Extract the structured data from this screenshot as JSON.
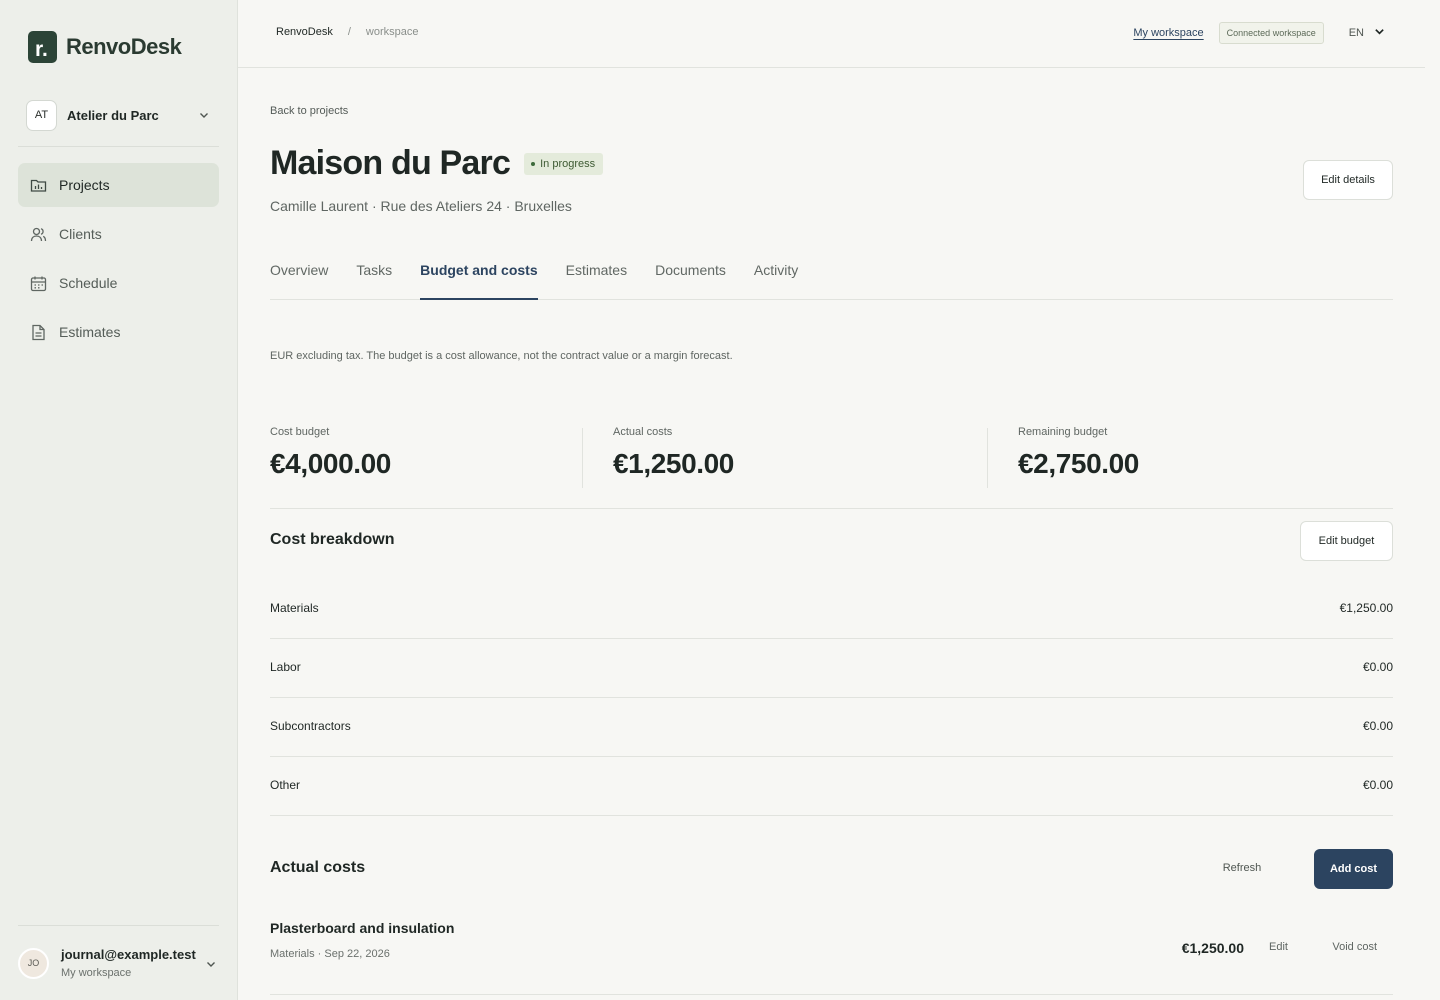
{
  "brand": {
    "mark": "r.",
    "name": "RenvoDesk"
  },
  "org": {
    "initials": "AT",
    "name": "Atelier du Parc"
  },
  "nav": [
    {
      "label": "Projects",
      "icon": "folder-icon"
    },
    {
      "label": "Clients",
      "icon": "users-icon"
    },
    {
      "label": "Schedule",
      "icon": "calendar-icon"
    },
    {
      "label": "Estimates",
      "icon": "document-icon"
    }
  ],
  "user": {
    "initials": "JO",
    "email": "journal@example.test",
    "workspace": "My workspace"
  },
  "topbar": {
    "breadcrumb": [
      "RenvoDesk",
      "/",
      "workspace"
    ],
    "workspace_link": "My workspace",
    "workspace_badge": "Connected workspace",
    "language": "EN"
  },
  "project": {
    "back": "Back to projects",
    "title": "Maison du Parc",
    "status": "In progress",
    "subtitle": "Camille Laurent · Rue des Ateliers 24 · Bruxelles",
    "edit_details": "Edit details"
  },
  "tabs": [
    "Overview",
    "Tasks",
    "Budget and costs",
    "Estimates",
    "Documents",
    "Activity"
  ],
  "active_tab": "Budget and costs",
  "note": "EUR excluding tax. The budget is a cost allowance, not the contract value or a margin forecast.",
  "stats": [
    {
      "label": "Cost budget",
      "value": "€4,000.00"
    },
    {
      "label": "Actual costs",
      "value": "€1,250.00"
    },
    {
      "label": "Remaining budget",
      "value": "€2,750.00"
    }
  ],
  "breakdown": {
    "title": "Cost breakdown",
    "edit_label": "Edit budget",
    "rows": [
      {
        "label": "Materials",
        "value": "€1,250.00"
      },
      {
        "label": "Labor",
        "value": "€0.00"
      },
      {
        "label": "Subcontractors",
        "value": "€0.00"
      },
      {
        "label": "Other",
        "value": "€0.00"
      }
    ]
  },
  "actual_costs": {
    "title": "Actual costs",
    "refresh_label": "Refresh",
    "add_label": "Add cost",
    "items": [
      {
        "name": "Plasterboard and insulation",
        "meta": "Materials · Sep 22, 2026",
        "amount": "€1,250.00",
        "edit": "Edit",
        "void": "Void cost"
      }
    ]
  },
  "colors": {
    "brand": "#2c4437",
    "accent": "#2c4460",
    "status_bg": "#e4ebdb",
    "status_text": "#3d5a32"
  }
}
